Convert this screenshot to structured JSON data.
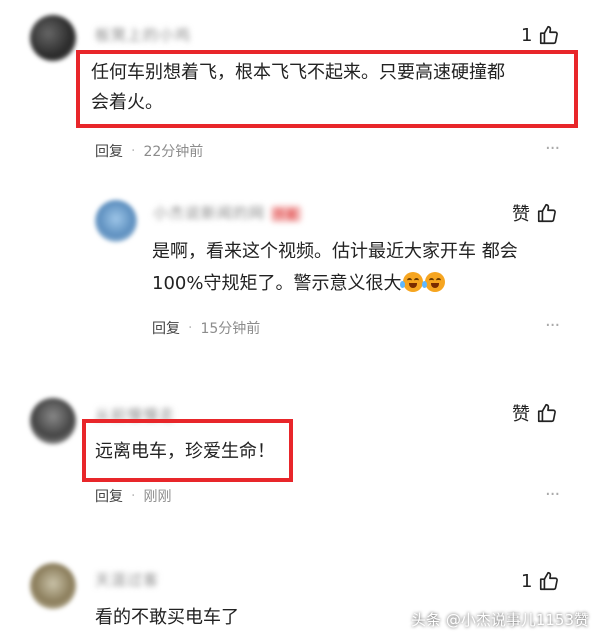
{
  "comments": [
    {
      "user_name": "板凳上的小鸡",
      "like_count": "1",
      "text_line1": "任何车别想着飞，根本飞飞不起来。只要高速硬撞都",
      "text_line2": "会着火。",
      "reply_label": "回复",
      "time": "22分钟前"
    },
    {
      "user_name": "小杰说新闻的网",
      "user_tag": "作者",
      "like_label": "赞",
      "text_line1": "是啊，看来这个视频。估计最近大家开车 都会",
      "text_line2": "100%守规矩了。警示意义很大",
      "reply_label": "回复",
      "time": "15分钟前"
    },
    {
      "user_name": "从前慢慢走",
      "like_label": "赞",
      "text_line1": "远离电车，珍爱生命！",
      "reply_label": "回复",
      "time": "刚刚"
    },
    {
      "user_name": "天涯过客",
      "like_count": "1",
      "text_line1": "看的不敢买电车了"
    }
  ],
  "more_label": "···",
  "watermark": "头条 @小杰说事儿1153赞",
  "colors": {
    "highlight_box": "#e8262a",
    "text": "#222222",
    "meta": "#8c8c8c"
  },
  "icons": {
    "like": "thumbs-up-icon",
    "more": "more-dots-icon",
    "emoji": "laugh-cry-emoji-icon"
  }
}
